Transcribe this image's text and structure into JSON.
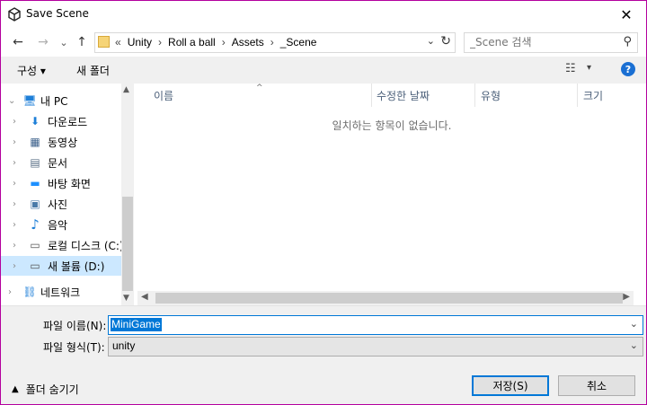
{
  "window": {
    "title": "Save Scene",
    "close_glyph": "✕"
  },
  "nav_buttons": {
    "back": "←",
    "forward": "→",
    "recent": "⌄",
    "up": "↑"
  },
  "address": {
    "crumbs": [
      "«",
      "Unity",
      "›",
      "Roll a ball",
      "›",
      "Assets",
      "›",
      "_Scene"
    ],
    "dropdown": "⌄",
    "refresh": "↻"
  },
  "search": {
    "placeholder": "_Scene 검색",
    "icon": "⚲"
  },
  "toolbar": {
    "organize": "구성 ▾",
    "new_folder": "새 폴더",
    "view_icon": "☷",
    "view_dropdown": "▾",
    "help": "?"
  },
  "nav_tree": [
    {
      "label": "내 PC",
      "icon": "🖥",
      "chev": "⌄"
    },
    {
      "label": "다운로드",
      "icon": "⬇",
      "chev": "›"
    },
    {
      "label": "동영상",
      "icon": "▦",
      "chev": "›"
    },
    {
      "label": "문서",
      "icon": "▤",
      "chev": "›"
    },
    {
      "label": "바탕 화면",
      "icon": "▬",
      "chev": "›"
    },
    {
      "label": "사진",
      "icon": "▣",
      "chev": "›"
    },
    {
      "label": "음악",
      "icon": "♪",
      "chev": "›"
    },
    {
      "label": "로컬 디스크 (C:)",
      "icon": "▭",
      "chev": "›"
    },
    {
      "label": "새 볼륨 (D:)",
      "icon": "▭",
      "chev": "›"
    },
    {
      "label": "네트워크",
      "icon": "⛓",
      "chev": "›"
    }
  ],
  "columns": [
    "이름",
    "수정한 날짜",
    "유형",
    "크기"
  ],
  "empty_message": "일치하는 항목이 없습니다.",
  "form": {
    "filename_label": "파일 이름(N):",
    "filename_value": "MiniGame",
    "filetype_label": "파일 형식(T):",
    "filetype_value": "unity",
    "dropdown": "⌄"
  },
  "footer": {
    "hide_folders": "폴더 숨기기",
    "hide_caret": "▲",
    "save": "저장(S)",
    "cancel": "취소"
  },
  "colors": {
    "accent": "#0078d7",
    "border": "#b4009e",
    "selected_nav": "#cce8ff"
  }
}
